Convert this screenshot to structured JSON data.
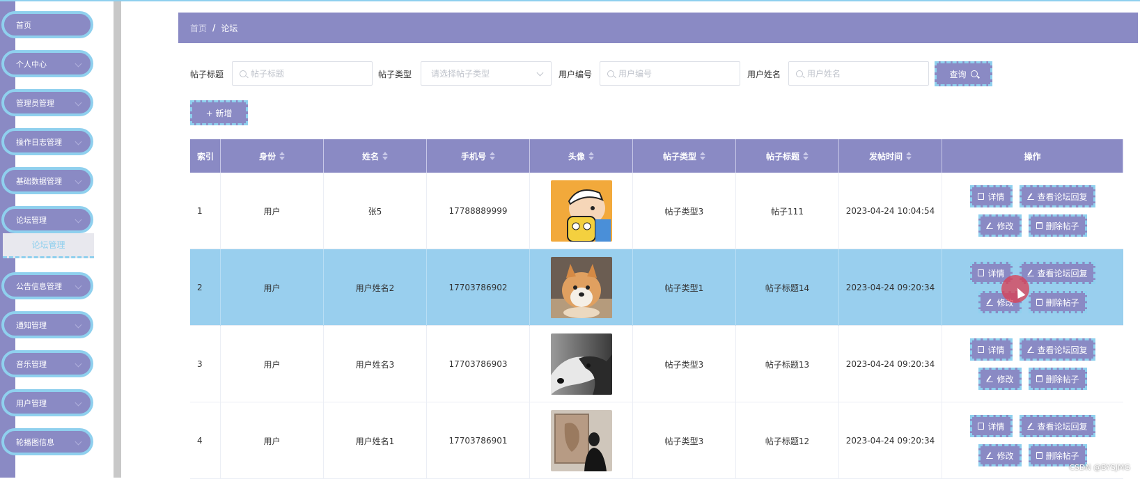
{
  "sidebar": {
    "items": [
      {
        "label": "首页",
        "has_arrow": false
      },
      {
        "label": "个人中心",
        "has_arrow": true
      },
      {
        "label": "管理员管理",
        "has_arrow": true
      },
      {
        "label": "操作日志管理",
        "has_arrow": true
      },
      {
        "label": "基础数据管理",
        "has_arrow": true
      },
      {
        "label": "论坛管理",
        "has_arrow": true
      },
      {
        "label": "公告信息管理",
        "has_arrow": true
      },
      {
        "label": "通知管理",
        "has_arrow": true
      },
      {
        "label": "音乐管理",
        "has_arrow": true
      },
      {
        "label": "用户管理",
        "has_arrow": true
      },
      {
        "label": "轮播图信息",
        "has_arrow": true
      }
    ],
    "submenu_active": "论坛管理"
  },
  "breadcrumb": {
    "home": "首页",
    "separator": "/",
    "current": "论坛"
  },
  "search": {
    "title_label": "帖子标题",
    "title_placeholder": "帖子标题",
    "type_label": "帖子类型",
    "type_placeholder": "请选择帖子类型",
    "user_no_label": "用户编号",
    "user_no_placeholder": "用户编号",
    "user_name_label": "用户姓名",
    "user_name_placeholder": "用户姓名",
    "query_button": "查询"
  },
  "toolbar": {
    "add_button": "+ 新增"
  },
  "table": {
    "headers": [
      "索引",
      "身份",
      "姓名",
      "手机号",
      "头像",
      "帖子类型",
      "帖子标题",
      "发帖时间",
      "操作"
    ],
    "rows": [
      {
        "index": "1",
        "role": "用户",
        "name": "张5",
        "phone": "17788889999",
        "type": "帖子类型3",
        "title": "帖子111",
        "time": "2023-04-24 10:04:54",
        "highlighted": false
      },
      {
        "index": "2",
        "role": "用户",
        "name": "用户姓名2",
        "phone": "17703786902",
        "type": "帖子类型1",
        "title": "帖子标题14",
        "time": "2023-04-24 09:20:34",
        "highlighted": true
      },
      {
        "index": "3",
        "role": "用户",
        "name": "用户姓名3",
        "phone": "17703786903",
        "type": "帖子类型3",
        "title": "帖子标题13",
        "time": "2023-04-24 09:20:34",
        "highlighted": false
      },
      {
        "index": "4",
        "role": "用户",
        "name": "用户姓名1",
        "phone": "17703786901",
        "type": "帖子类型3",
        "title": "帖子标题12",
        "time": "2023-04-24 09:20:34",
        "highlighted": false
      }
    ],
    "actions": {
      "detail": "详情",
      "view_replies": "查看论坛回复",
      "edit": "修改",
      "delete": "删除帖子"
    }
  },
  "watermark": "CSDN @BYSJMG",
  "colors": {
    "primary": "#8a8ac4",
    "accent": "#8fd0ee",
    "highlight_row": "#99cfee"
  }
}
